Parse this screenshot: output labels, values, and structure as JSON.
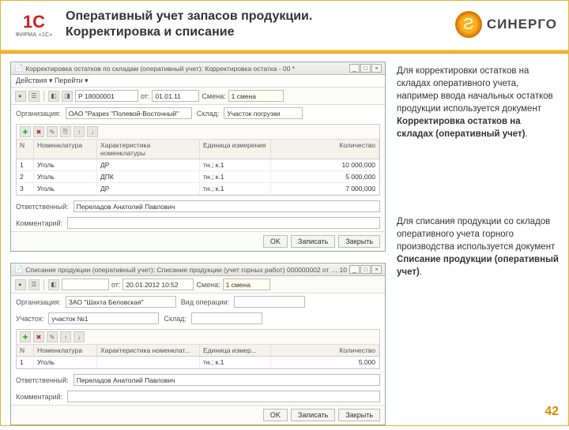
{
  "header": {
    "logo1c_top": "1C",
    "logo1c_bot": "ФИРМА «1С»",
    "title_l1": "Оперативный учет запасов продукции.",
    "title_l2": "Корректировка и списание",
    "synergo": "СИНЕРГО"
  },
  "desc": {
    "p1a": "Для корректировки остатков на складах оперативного учета, например ввода начальных остатков продукции используется документ ",
    "p1b": "Корректировка остатков на складах (оперативный учет)",
    "p2a": "Для списания продукции со складов оперативного учета горного производства используется документ ",
    "p2b": "Списание продукции (оперативный учет)"
  },
  "win1": {
    "title": "Корректировка остатков по складам (оперативный учет): Корректировка остатка - 00 *",
    "menu": "Действия ▾   Перейти ▾",
    "number": "Р 18000001",
    "date": "01.01.11",
    "shift_lbl": "Смена:",
    "shift": "1 смена",
    "org_lbl": "Организация:",
    "org": "ОАО \"Разрез \"Полевой-Восточный\"",
    "store_lbl": "Склад:",
    "store": "Участок погрузки",
    "cols": {
      "n": "N",
      "nom": "Номенклатура",
      "char": "Характеристика номенклатуры",
      "ed": "Единица измерения",
      "qty": "Количество"
    },
    "rows": [
      {
        "n": "1",
        "nom": "Уголь",
        "char": "ДР",
        "ed": "тн.; к.1",
        "qty": "10 000,000"
      },
      {
        "n": "2",
        "nom": "Уголь",
        "char": "ДПК",
        "ed": "тн.; к.1",
        "qty": "5 000,000"
      },
      {
        "n": "3",
        "nom": "Уголь",
        "char": "ДР",
        "ed": "тн.; к.1",
        "qty": "7 000,000"
      }
    ],
    "resp_lbl": "Ответственный:",
    "resp": "Переладов Анатолий Павлович",
    "comm_lbl": "Комментарий:",
    "ok": "OK",
    "save": "Записать",
    "close": "Закрыть"
  },
  "win2": {
    "title": "Списание продукции (оперативный учет): Списание продукции (учет горных работ) 000000002 от … 10",
    "number": "",
    "date": "20.01.2012 10:52",
    "shift_lbl": "Смена:",
    "shift": "1 смена",
    "org_lbl": "Организация:",
    "org": "ЗАО \"Шахта Беловская\"",
    "vid_lbl": "Вид операции:",
    "vid": "",
    "store_lbl": "Участок:",
    "store": "участок №1",
    "sklad_lbl": "Склад:",
    "sklad": "",
    "cols": {
      "n": "N",
      "nom": "Номенклатура",
      "char": "Характеристика номенклат...",
      "ed": "Единица измер...",
      "qty": "Количество"
    },
    "rows": [
      {
        "n": "1",
        "nom": "Уголь",
        "char": "",
        "ed": "тн.; к.1",
        "qty": "5,000"
      }
    ],
    "resp_lbl": "Ответственный:",
    "resp": "Переладов Анатолий Павлович",
    "comm_lbl": "Комментарий:",
    "ok": "OK",
    "save": "Записать",
    "close": "Закрыть"
  },
  "pagenum": "42"
}
